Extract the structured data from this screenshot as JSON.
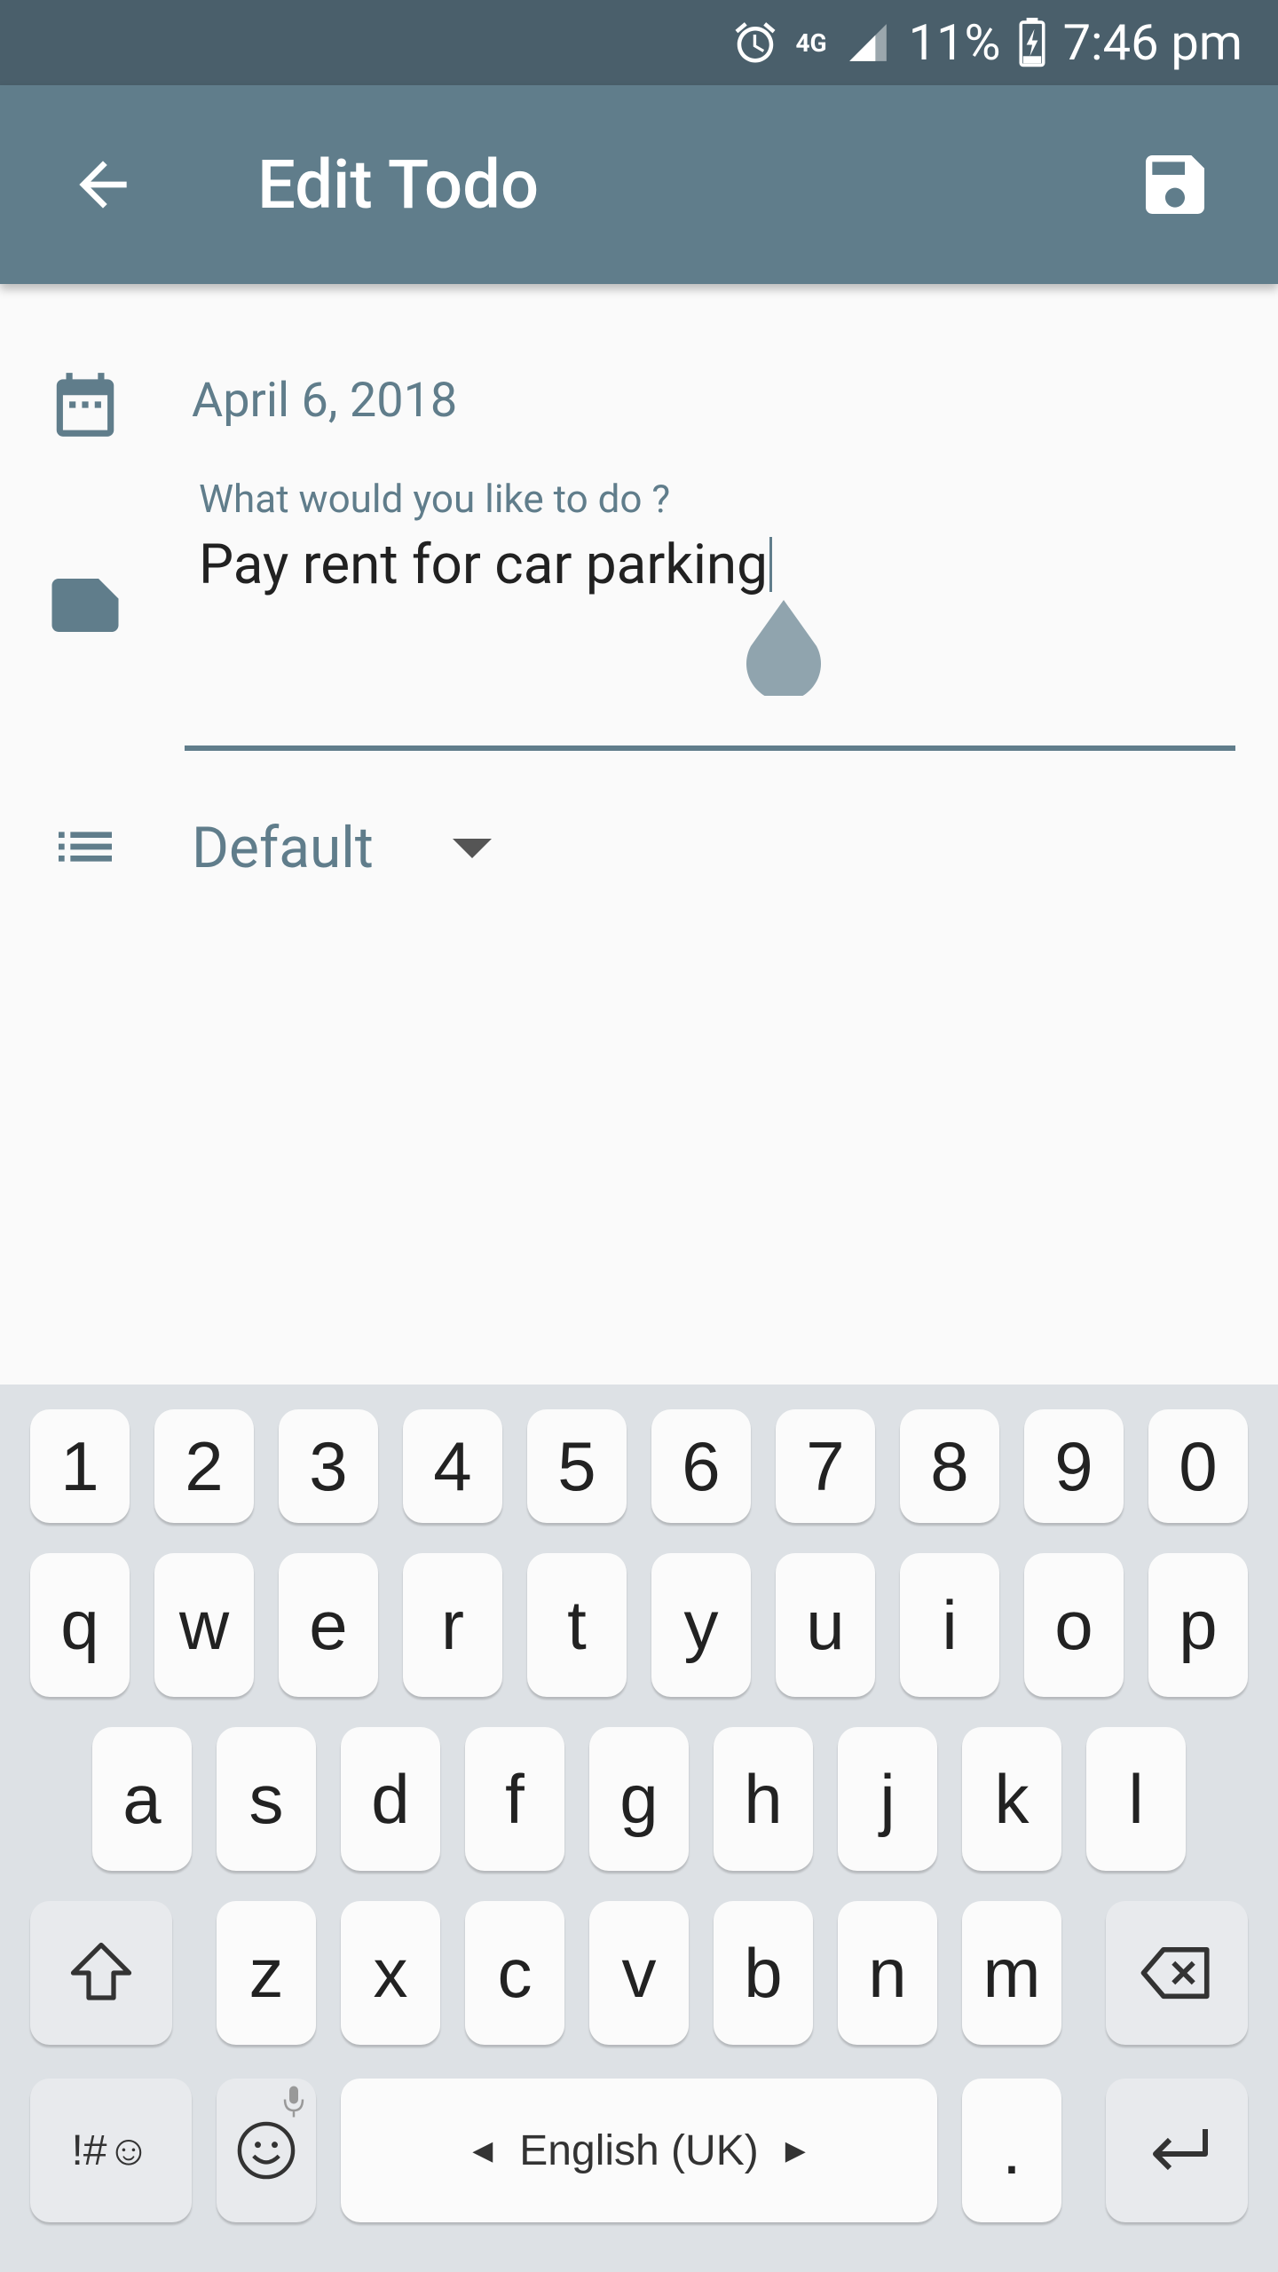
{
  "status_bar": {
    "network": "4G",
    "battery": "11%",
    "time": "7:46 pm"
  },
  "app_bar": {
    "title": "Edit Todo"
  },
  "form": {
    "date": "April 6, 2018",
    "todo_label": "What would you like to do ?",
    "todo_value": "Pay rent for car parking",
    "category": "Default"
  },
  "keyboard": {
    "row_numbers": [
      "1",
      "2",
      "3",
      "4",
      "5",
      "6",
      "7",
      "8",
      "9",
      "0"
    ],
    "row_top": [
      "q",
      "w",
      "e",
      "r",
      "t",
      "y",
      "u",
      "i",
      "o",
      "p"
    ],
    "row_mid": [
      "a",
      "s",
      "d",
      "f",
      "g",
      "h",
      "j",
      "k",
      "l"
    ],
    "row_bottom": [
      "z",
      "x",
      "c",
      "v",
      "b",
      "n",
      "m"
    ],
    "symbols_label": "!#☺",
    "space_label": "English (UK)",
    "period_label": "."
  },
  "colors": {
    "status_bar": "#4a5f6b",
    "app_bar": "#607d8b",
    "accent": "#607d8b"
  }
}
